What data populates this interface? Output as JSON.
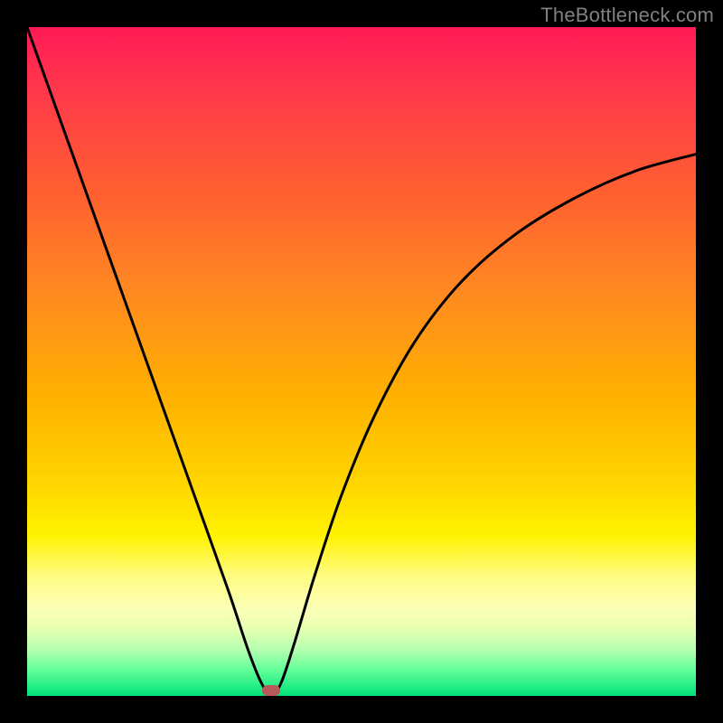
{
  "watermark": "TheBottleneck.com",
  "colors": {
    "background": "#000000",
    "curve": "#000000",
    "marker": "#b95a5a"
  },
  "chart_data": {
    "type": "line",
    "title": "",
    "xlabel": "",
    "ylabel": "",
    "xlim": [
      0,
      100
    ],
    "ylim": [
      0,
      100
    ],
    "grid": false,
    "series": [
      {
        "name": "bottleneck-curve",
        "x": [
          0,
          5,
          10,
          15,
          20,
          25,
          30,
          33,
          35,
          36.5,
          38,
          40,
          43,
          47,
          52,
          58,
          65,
          73,
          82,
          91,
          100
        ],
        "values": [
          100,
          86,
          72,
          58,
          44,
          30,
          16,
          7,
          2,
          0,
          2,
          8,
          18,
          30,
          42,
          53,
          62,
          69,
          74.5,
          78.5,
          81
        ]
      }
    ],
    "marker": {
      "x": 36.5,
      "y": 0.8
    },
    "gradient_stops": [
      {
        "pos": 0,
        "color": "#ff1a55"
      },
      {
        "pos": 10,
        "color": "#ff3a4a"
      },
      {
        "pos": 25,
        "color": "#ff6030"
      },
      {
        "pos": 40,
        "color": "#ff8a20"
      },
      {
        "pos": 55,
        "color": "#ffb000"
      },
      {
        "pos": 68,
        "color": "#ffd400"
      },
      {
        "pos": 76,
        "color": "#fff200"
      },
      {
        "pos": 82,
        "color": "#fffb80"
      },
      {
        "pos": 87,
        "color": "#fbffb8"
      },
      {
        "pos": 90,
        "color": "#e6ffb0"
      },
      {
        "pos": 93,
        "color": "#b5ffb0"
      },
      {
        "pos": 96,
        "color": "#66ff99"
      },
      {
        "pos": 100,
        "color": "#00e37a"
      }
    ]
  }
}
